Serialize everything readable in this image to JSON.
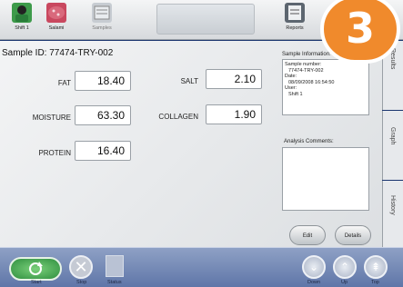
{
  "toolbar": {
    "buttons": [
      {
        "label": "Shift 1",
        "icon": "user-icon"
      },
      {
        "label": "Salami",
        "icon": "salami-icon"
      },
      {
        "label": "Samples",
        "icon": "samples-icon"
      },
      {
        "label": "Reports",
        "icon": "reports-icon"
      }
    ]
  },
  "badge": "3",
  "sample": {
    "title": "Sample ID: 77474-TRY-002",
    "fields": {
      "fat": {
        "label": "FAT",
        "value": "18.40"
      },
      "salt": {
        "label": "SALT",
        "value": "2.10"
      },
      "moisture": {
        "label": "MOISTURE",
        "value": "63.30"
      },
      "collagen": {
        "label": "COLLAGEN",
        "value": "1.90"
      },
      "protein": {
        "label": "PROTEIN",
        "value": "16.40"
      }
    }
  },
  "info": {
    "title": "Sample Information:",
    "sample_number_label": "Sample number:",
    "sample_number": "77474-TRY-002",
    "date_label": "Date:",
    "date": "08/09/2008 16:54:50",
    "user_label": "User:",
    "user": "Shift 1"
  },
  "comments": {
    "title": "Analysis Comments:"
  },
  "actions": {
    "edit": "Edit",
    "details": "Details"
  },
  "tabs": [
    "Results",
    "Graph",
    "History"
  ],
  "bottom": {
    "start": "Start",
    "stop": "Stop",
    "status": "Status",
    "down": "Down",
    "up": "Up",
    "top": "Top"
  },
  "colors": {
    "accent": "#f08a2c",
    "frame": "#1a356f"
  }
}
